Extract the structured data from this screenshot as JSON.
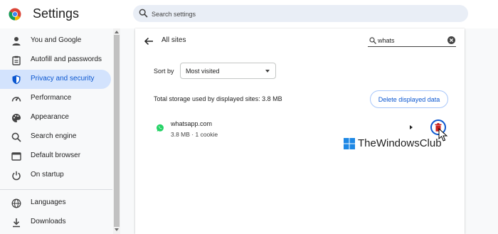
{
  "header": {
    "title": "Settings",
    "search_placeholder": "Search settings"
  },
  "sidebar": {
    "items": [
      {
        "label": "You and Google",
        "icon": "person-icon"
      },
      {
        "label": "Autofill and passwords",
        "icon": "clipboard-icon"
      },
      {
        "label": "Privacy and security",
        "icon": "shield-icon",
        "active": true
      },
      {
        "label": "Performance",
        "icon": "speedometer-icon"
      },
      {
        "label": "Appearance",
        "icon": "palette-icon"
      },
      {
        "label": "Search engine",
        "icon": "search-icon"
      },
      {
        "label": "Default browser",
        "icon": "browser-window-icon"
      },
      {
        "label": "On startup",
        "icon": "power-icon"
      },
      {
        "label": "Languages",
        "icon": "globe-icon"
      },
      {
        "label": "Downloads",
        "icon": "download-icon"
      }
    ]
  },
  "main": {
    "title": "All sites",
    "filter_value": "whats",
    "sort_label": "Sort by",
    "sort_value": "Most visited",
    "storage_text": "Total storage used by displayed sites: 3.8 MB",
    "delete_all_label": "Delete displayed data",
    "sites": [
      {
        "name": "whatsapp.com",
        "meta": "3.8 MB · 1 cookie"
      }
    ]
  },
  "watermark": {
    "text": "TheWindowsClub"
  },
  "colors": {
    "accent": "#0b57d0",
    "active_bg": "#d3e3fd",
    "whatsapp": "#25d366"
  }
}
